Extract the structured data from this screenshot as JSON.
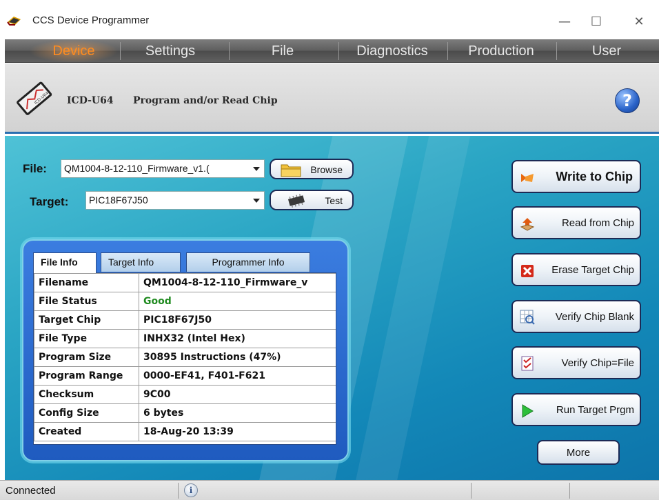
{
  "window": {
    "title": "CCS Device Programmer",
    "minimize": "—",
    "maximize": "☐",
    "close": "✕"
  },
  "menu": [
    "Device",
    "Settings",
    "File",
    "Diagnostics",
    "Production",
    "User"
  ],
  "active_menu": "Device",
  "header": {
    "device": "ICD-U64",
    "description": "Program and/or Read Chip",
    "help": "?"
  },
  "file": {
    "label": "File:",
    "value": "QM1004-8-12-110_Firmware_v1.(",
    "browse": "Browse"
  },
  "target": {
    "label": "Target:",
    "value": "PIC18F67J50",
    "test": "Test"
  },
  "tabs": [
    "File Info",
    "Target Info",
    "Programmer Info"
  ],
  "active_tab": "File Info",
  "file_info": [
    {
      "key": "Filename",
      "value": "QM1004-8-12-110_Firmware_v"
    },
    {
      "key": "File Status",
      "value": "Good"
    },
    {
      "key": "Target Chip",
      "value": "PIC18F67J50"
    },
    {
      "key": "File Type",
      "value": "INHX32 (Intel Hex)"
    },
    {
      "key": "Program Size",
      "value": "30895 Instructions (47%)"
    },
    {
      "key": "Program Range",
      "value": "0000-EF41, F401-F621"
    },
    {
      "key": "Checksum",
      "value": "9C00"
    },
    {
      "key": "Config Size",
      "value": "6 bytes"
    },
    {
      "key": "Created",
      "value": "18-Aug-20 13:39"
    }
  ],
  "colors": {
    "status_good": "#1f8a1f",
    "accent_menu": "#ff8c20",
    "main_bg": "#2aa5c4"
  },
  "actions": {
    "write": "Write to Chip",
    "read": "Read from Chip",
    "erase": "Erase Target Chip",
    "verify_blank": "Verify Chip Blank",
    "verify_file": "Verify Chip=File",
    "run": "Run Target Prgm",
    "more": "More"
  },
  "status": {
    "text": "Connected",
    "info_icon": "i"
  }
}
